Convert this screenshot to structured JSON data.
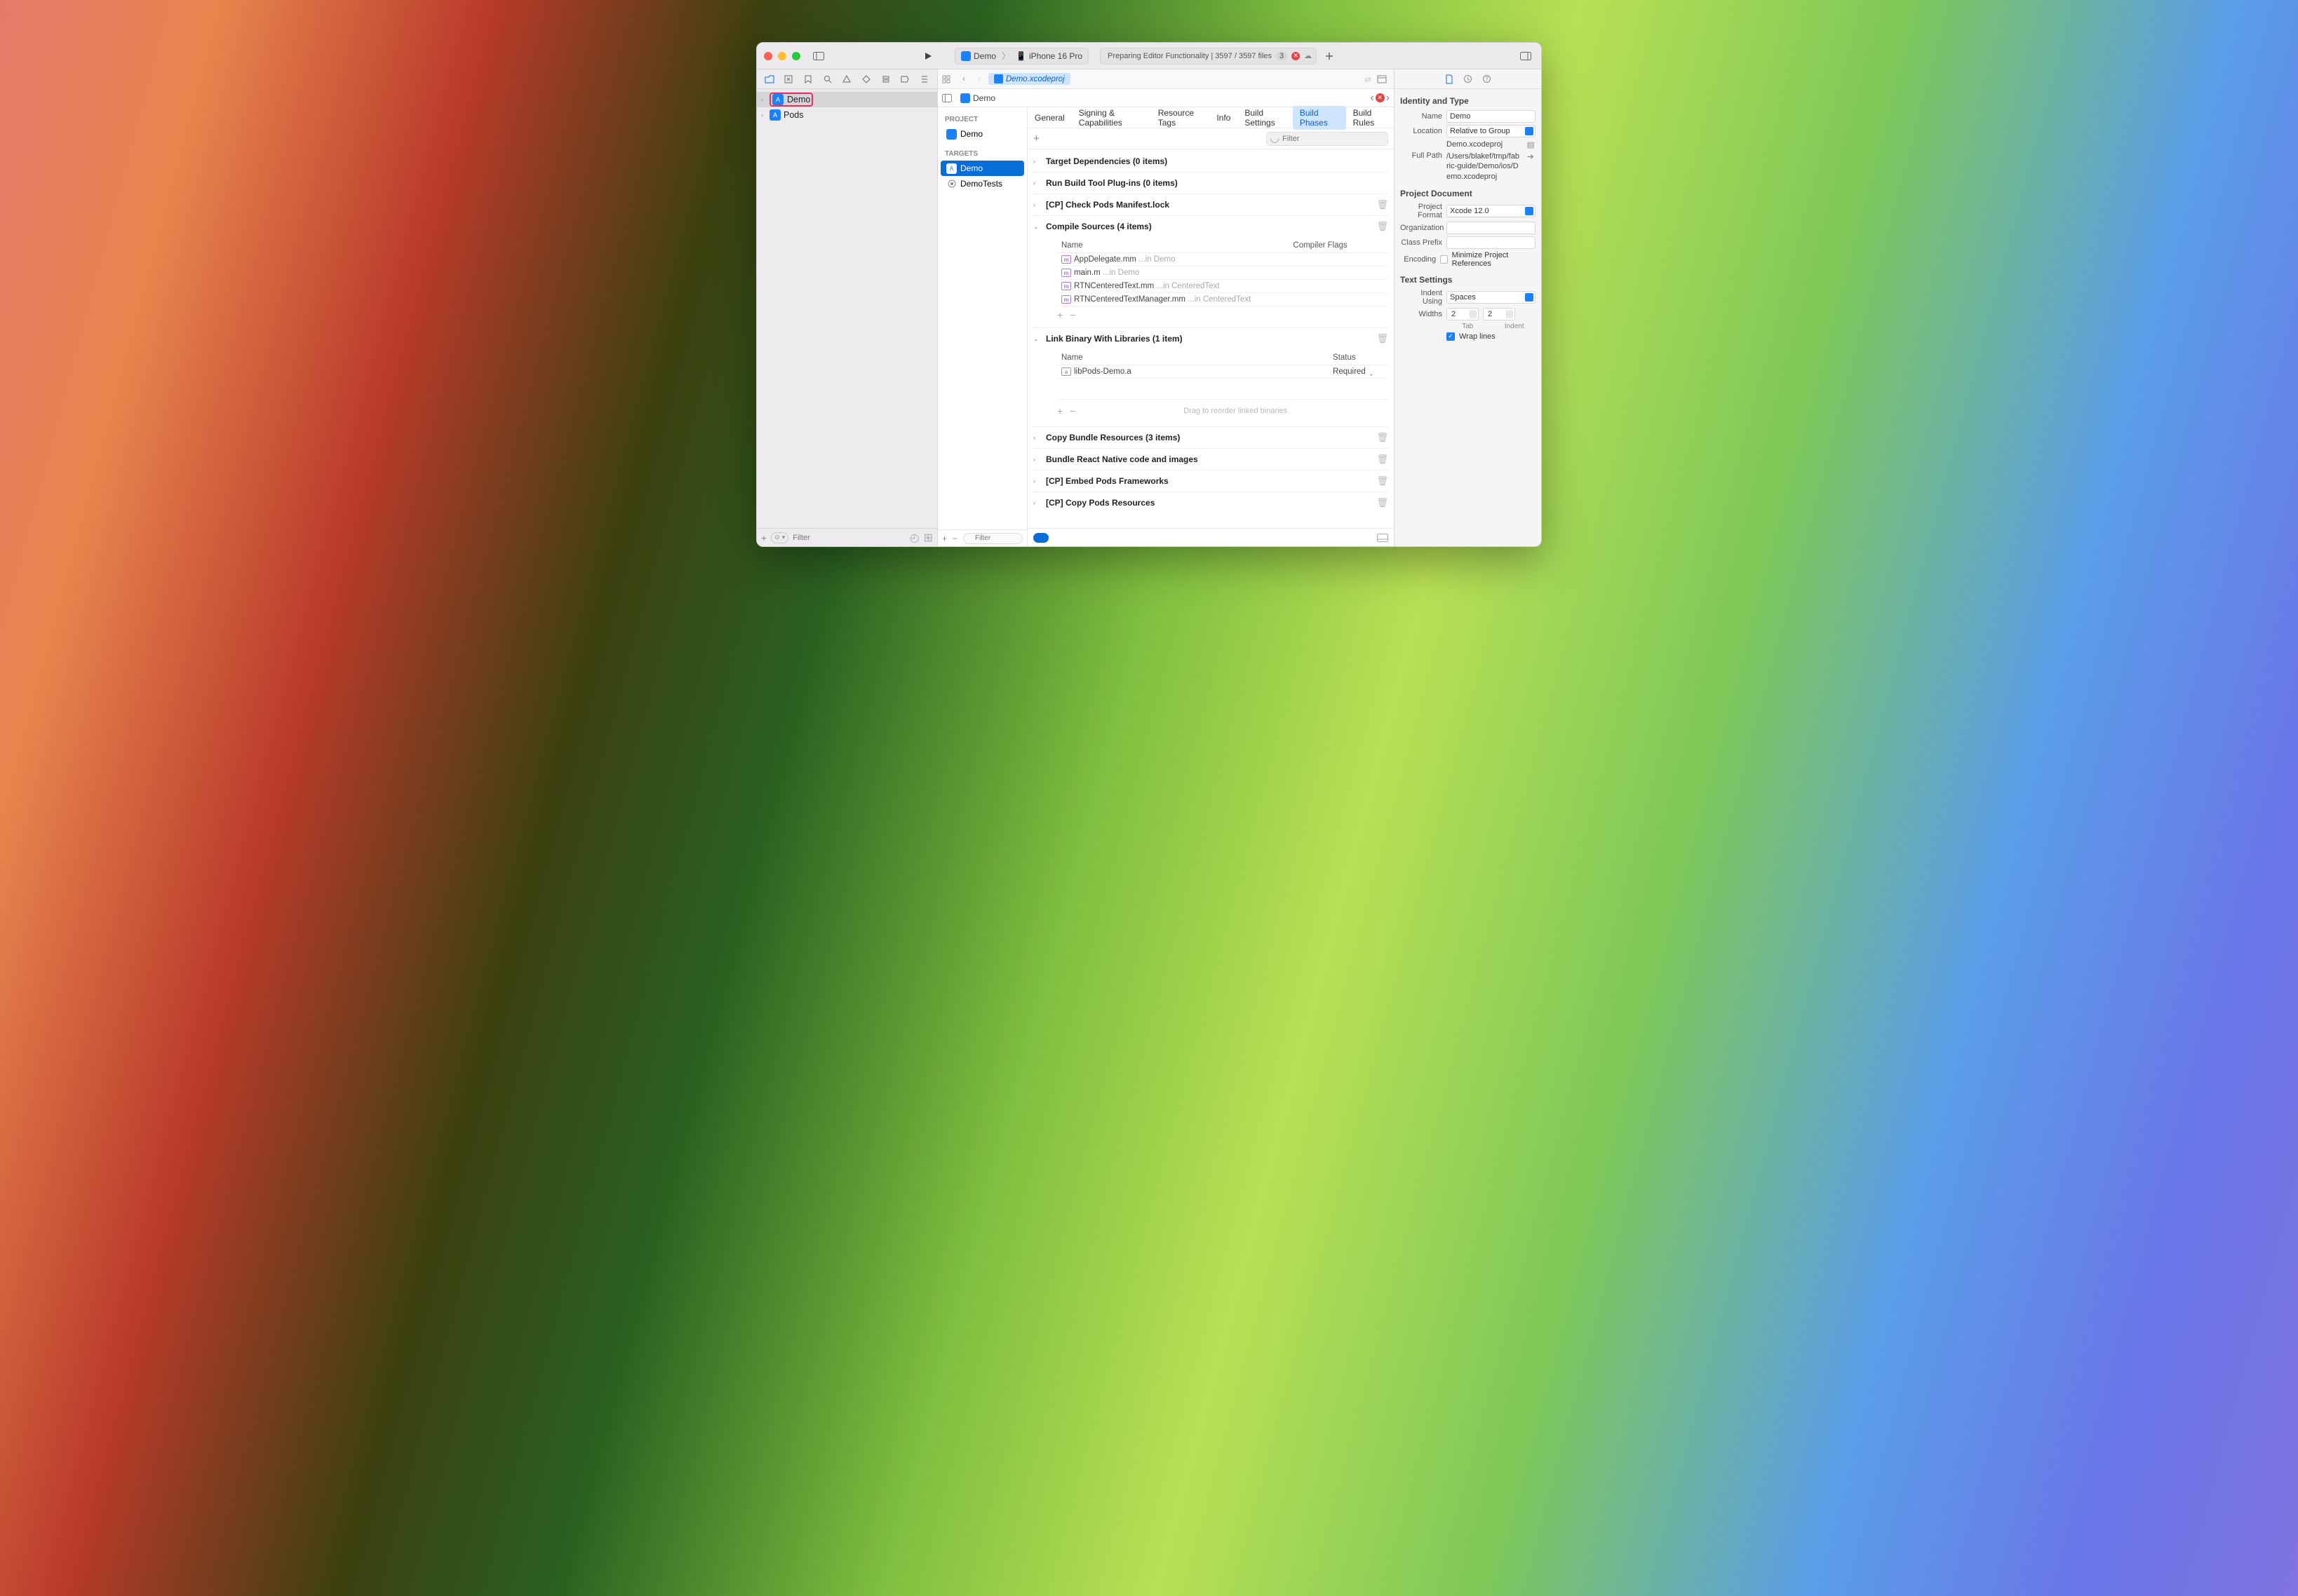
{
  "toolbar": {
    "scheme": "Demo",
    "device": "iPhone 16 Pro",
    "status_text": "Preparing Editor Functionality | 3597 / 3597 files",
    "badge_count": "3"
  },
  "navigator": {
    "items": [
      {
        "name": "Demo",
        "selected": true,
        "highlighted": true
      },
      {
        "name": "Pods",
        "selected": false,
        "highlighted": false
      }
    ],
    "filter_placeholder": "Filter"
  },
  "jumpbar": {
    "crumb": "Demo.xcodeproj"
  },
  "subtabs": {
    "label": "Demo"
  },
  "targets": {
    "project_header": "PROJECT",
    "project_item": "Demo",
    "targets_header": "TARGETS",
    "items": [
      {
        "name": "Demo",
        "selected": true,
        "icon": "app"
      },
      {
        "name": "DemoTests",
        "selected": false,
        "icon": "test"
      }
    ],
    "filter_placeholder": "Filter"
  },
  "settings_tabs": [
    "General",
    "Signing & Capabilities",
    "Resource Tags",
    "Info",
    "Build Settings",
    "Build Phases",
    "Build Rules"
  ],
  "settings_tabs_active": "Build Phases",
  "phase_filter_placeholder": "Filter",
  "phases": {
    "target_deps": "Target Dependencies (0 items)",
    "run_plugins": "Run Build Tool Plug-ins (0 items)",
    "check_pods": "[CP] Check Pods Manifest.lock",
    "compile_sources": {
      "title": "Compile Sources (4 items)",
      "col_name": "Name",
      "col_flags": "Compiler Flags",
      "rows": [
        {
          "file": "AppDelegate.mm",
          "loc": "...in Demo",
          "kind": "m"
        },
        {
          "file": "main.m",
          "loc": "...in Demo",
          "kind": "m"
        },
        {
          "file": "RTNCenteredText.mm",
          "loc": "...in CenteredText",
          "kind": "m"
        },
        {
          "file": "RTNCenteredTextManager.mm",
          "loc": "...in CenteredText",
          "kind": "m"
        }
      ]
    },
    "link_binary": {
      "title": "Link Binary With Libraries (1 item)",
      "col_name": "Name",
      "col_status": "Status",
      "rows": [
        {
          "file": "libPods-Demo.a",
          "status": "Required"
        }
      ],
      "drag_hint": "Drag to reorder linked binaries"
    },
    "copy_bundle": "Copy Bundle Resources (3 items)",
    "bundle_rn": "Bundle React Native code and images",
    "embed_pods": "[CP] Embed Pods Frameworks",
    "copy_pods": "[CP] Copy Pods Resources"
  },
  "inspector": {
    "section_identity": "Identity and Type",
    "name_label": "Name",
    "name_value": "Demo",
    "location_label": "Location",
    "location_value": "Relative to Group",
    "location_path": "Demo.xcodeproj",
    "fullpath_label": "Full Path",
    "fullpath_value": "/Users/blakef/tmp/fabric-guide/Demo/ios/Demo.xcodeproj",
    "section_projdoc": "Project Document",
    "projformat_label": "Project Format",
    "projformat_value": "Xcode 12.0",
    "org_label": "Organization",
    "classprefix_label": "Class Prefix",
    "encoding_label": "Encoding",
    "minimize_label": "Minimize Project References",
    "section_text": "Text Settings",
    "indent_using_label": "Indent Using",
    "indent_using_value": "Spaces",
    "widths_label": "Widths",
    "tab_width": "2",
    "indent_width": "2",
    "tab_sub": "Tab",
    "indent_sub": "Indent",
    "wrap_label": "Wrap lines"
  }
}
